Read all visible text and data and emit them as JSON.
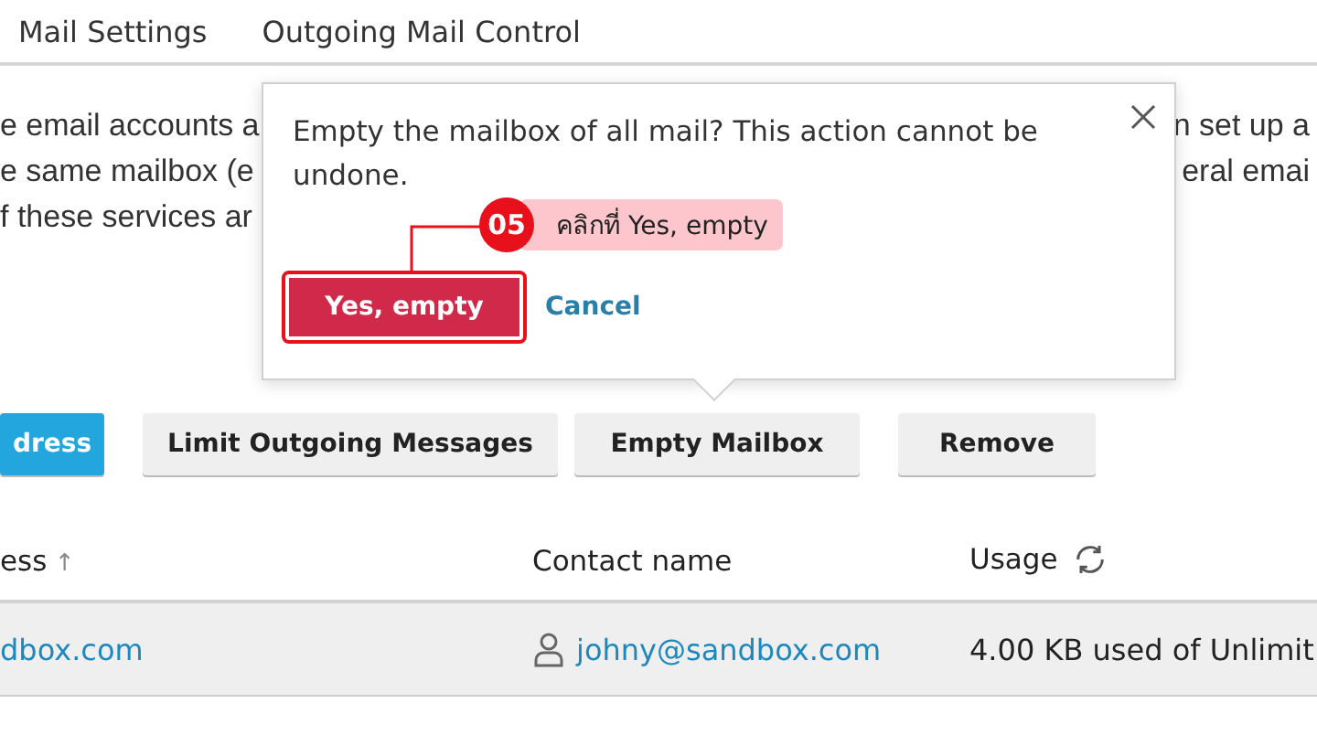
{
  "tabs": [
    {
      "label": "Mail Settings"
    },
    {
      "label": "Outgoing Mail Control"
    }
  ],
  "description_lines": [
    {
      "left": "e email accounts a",
      "right": "n set up a"
    },
    {
      "left": "e same mailbox (e",
      "right": "eral emai"
    },
    {
      "left": "f these services ar"
    }
  ],
  "toolbar": [
    {
      "label": "dress",
      "kind": "primary"
    },
    {
      "label": "Limit Outgoing Messages",
      "kind": "default"
    },
    {
      "label": "Empty Mailbox",
      "kind": "default"
    },
    {
      "label": "Remove",
      "kind": "default"
    }
  ],
  "table": {
    "columns": [
      {
        "label": "ess",
        "sort": "↑"
      },
      {
        "label": "Contact name"
      },
      {
        "label": "Usage"
      }
    ],
    "rows": [
      {
        "address": "dbox.com",
        "contact": "johny@sandbox.com",
        "usage": "4.00 KB used of Unlimit"
      }
    ]
  },
  "popover": {
    "message": "Empty the mailbox of all mail? This action cannot be undone.",
    "confirm": "Yes, empty",
    "cancel": "Cancel"
  },
  "annotation": {
    "step": "05",
    "text": "คลิกที่ Yes, empty"
  }
}
